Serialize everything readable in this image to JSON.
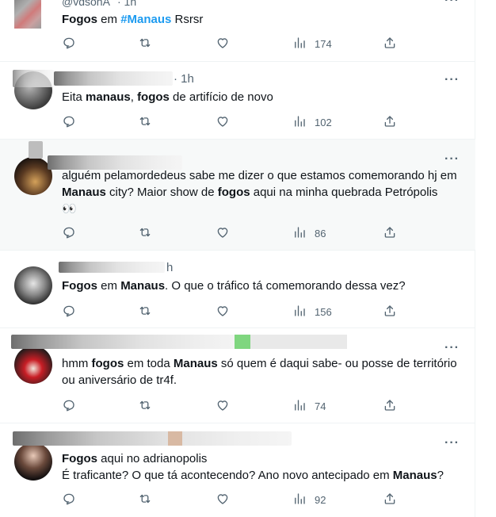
{
  "tweets": [
    {
      "handle": "@vdsonA",
      "time": "· 1h",
      "text_parts": [
        {
          "t": "Fogos",
          "s": "b"
        },
        {
          "t": " em ",
          "s": ""
        },
        {
          "t": "#Manaus",
          "s": "hash"
        },
        {
          "t": "  Rsrsr",
          "s": ""
        }
      ],
      "views": "174"
    },
    {
      "time": "· 1h",
      "text_parts": [
        {
          "t": "Eita ",
          "s": ""
        },
        {
          "t": "manaus",
          "s": "b"
        },
        {
          "t": ", ",
          "s": ""
        },
        {
          "t": "fogos",
          "s": "b"
        },
        {
          "t": " de artifício de novo",
          "s": ""
        }
      ],
      "views": "102"
    },
    {
      "time": "",
      "text_parts": [
        {
          "t": "alguém pelamordedeus sabe me dizer o que estamos comemorando hj em ",
          "s": ""
        },
        {
          "t": "Manaus",
          "s": "b"
        },
        {
          "t": " city? Maior show de ",
          "s": ""
        },
        {
          "t": "fogos",
          "s": "b"
        },
        {
          "t": " aqui na minha quebrada Petrópolis",
          "s": ""
        }
      ],
      "emoji": "👀",
      "views": "86"
    },
    {
      "time": "h",
      "text_parts": [
        {
          "t": "Fogos",
          "s": "b"
        },
        {
          "t": " em ",
          "s": ""
        },
        {
          "t": "Manaus",
          "s": "b"
        },
        {
          "t": ". O que o tráfico tá comemorando dessa vez?",
          "s": ""
        }
      ],
      "views": "156"
    },
    {
      "time": "",
      "text_parts": [
        {
          "t": "hmm ",
          "s": ""
        },
        {
          "t": "fogos",
          "s": "b"
        },
        {
          "t": " em toda ",
          "s": ""
        },
        {
          "t": "Manaus",
          "s": "b"
        },
        {
          "t": " só quem é daqui sabe- ou posse de território ou aniversário de tr4f.",
          "s": ""
        }
      ],
      "views": "74"
    },
    {
      "time": "",
      "text_parts": [
        {
          "t": "Fogos",
          "s": "b"
        },
        {
          "t": " aqui no adrianopolis",
          "s": ""
        },
        {
          "t": "\n",
          "s": "br"
        },
        {
          "t": "É traficante? O que tá acontecendo? Ano novo antecipado em ",
          "s": ""
        },
        {
          "t": "Manaus",
          "s": "b"
        },
        {
          "t": "?",
          "s": ""
        }
      ],
      "views": "92"
    }
  ],
  "icons": {
    "reply": "reply-icon",
    "retweet": "retweet-icon",
    "like": "heart-icon",
    "views": "views-icon",
    "share": "share-icon",
    "more": "more-icon"
  },
  "colors": {
    "text": "#0f1419",
    "muted": "#536471",
    "hashtag": "#1d9bf0",
    "highlight_bg": "#f7f9f9"
  }
}
